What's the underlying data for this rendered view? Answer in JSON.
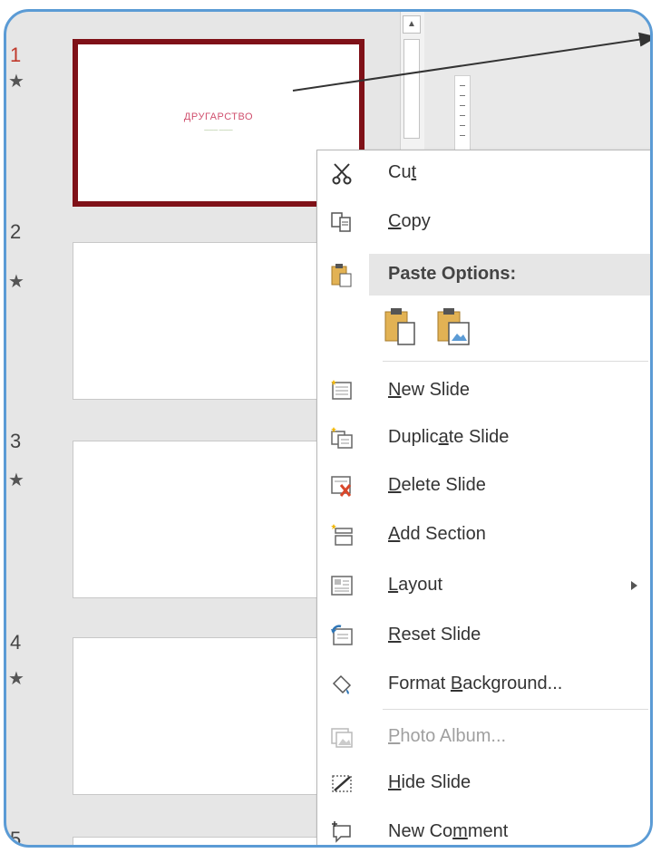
{
  "slides": [
    {
      "number": "1",
      "star": "★",
      "title": "ДРУГАРСТВО",
      "subtitle": "——— ———"
    },
    {
      "number": "2",
      "star": "★"
    },
    {
      "number": "3",
      "star": "★"
    },
    {
      "number": "4",
      "star": "★"
    },
    {
      "number": "5"
    }
  ],
  "scrollbar": {
    "up_arrow": "▲"
  },
  "context_menu": {
    "cut": {
      "pre": "Cu",
      "ul": "t",
      "post": ""
    },
    "copy": {
      "pre": "",
      "ul": "C",
      "post": "opy"
    },
    "paste_options": "Paste Options:",
    "new_slide": {
      "pre": "",
      "ul": "N",
      "post": "ew Slide"
    },
    "duplicate_slide": {
      "pre": "Duplic",
      "ul": "a",
      "post": "te Slide"
    },
    "delete_slide": {
      "pre": "",
      "ul": "D",
      "post": "elete Slide"
    },
    "add_section": {
      "pre": "",
      "ul": "A",
      "post": "dd Section"
    },
    "layout": {
      "pre": "",
      "ul": "L",
      "post": "ayout"
    },
    "reset_slide": {
      "pre": "",
      "ul": "R",
      "post": "eset Slide"
    },
    "format_background": {
      "pre": "Format ",
      "ul": "B",
      "post": "ackground..."
    },
    "photo_album": {
      "pre": "",
      "ul": "P",
      "post": "hoto Album..."
    },
    "hide_slide": {
      "pre": "",
      "ul": "H",
      "post": "ide Slide"
    },
    "new_comment": {
      "pre": "New Co",
      "ul": "m",
      "post": "ment"
    }
  },
  "colors": {
    "frame": "#5b9bd5",
    "selected_slide_border": "#7f1118",
    "selected_number": "#c0392b",
    "title_text": "#d0506e"
  }
}
